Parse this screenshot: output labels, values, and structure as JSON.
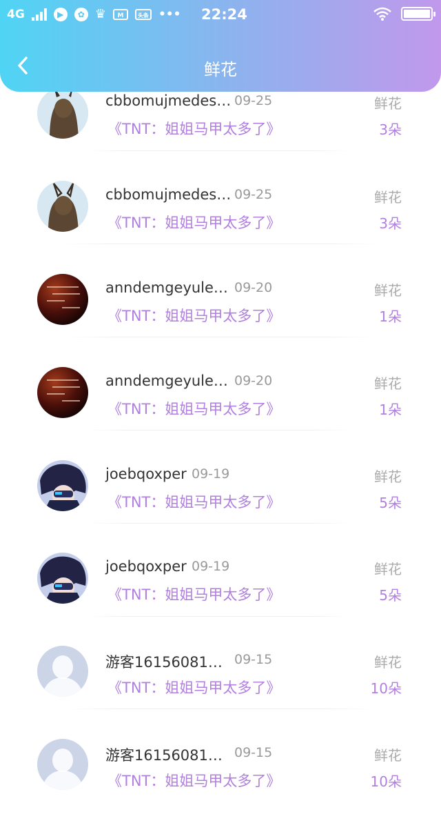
{
  "status_bar": {
    "network": "4G",
    "app_badge": "头条",
    "dots": "•••",
    "time": "22:24"
  },
  "nav": {
    "title": "鲜花"
  },
  "colors": {
    "accent": "#b17fe0",
    "header_start": "#4fd4f4",
    "header_end": "#c198ec"
  },
  "items": [
    {
      "name": "cbbomujmedes…",
      "date": "09-25",
      "book": "《TNT：姐姐马甲太多了》",
      "label": "鲜花",
      "count": "3朵",
      "avatar": "girl-bunny-ears"
    },
    {
      "name": "cbbomujmedes…",
      "date": "09-25",
      "book": "《TNT：姐姐马甲太多了》",
      "label": "鲜花",
      "count": "3朵",
      "avatar": "girl-bunny-ears"
    },
    {
      "name": "anndemgeyule…",
      "date": "09-20",
      "book": "《TNT：姐姐马甲太多了》",
      "label": "鲜花",
      "count": "1朵",
      "avatar": "dark-red-text"
    },
    {
      "name": "anndemgeyule…",
      "date": "09-20",
      "book": "《TNT：姐姐马甲太多了》",
      "label": "鲜花",
      "count": "1朵",
      "avatar": "dark-red-text"
    },
    {
      "name": "joebqoxper",
      "date": "09-19",
      "book": "《TNT：姐姐马甲太多了》",
      "label": "鲜花",
      "count": "5朵",
      "avatar": "anime-boy"
    },
    {
      "name": "joebqoxper",
      "date": "09-19",
      "book": "《TNT：姐姐马甲太多了》",
      "label": "鲜花",
      "count": "5朵",
      "avatar": "anime-boy"
    },
    {
      "name": "游客16156081…",
      "date": "09-15",
      "book": "《TNT：姐姐马甲太多了》",
      "label": "鲜花",
      "count": "10朵",
      "avatar": "default-person"
    },
    {
      "name": "游客16156081…",
      "date": "09-15",
      "book": "《TNT：姐姐马甲太多了》",
      "label": "鲜花",
      "count": "10朵",
      "avatar": "default-person"
    }
  ]
}
